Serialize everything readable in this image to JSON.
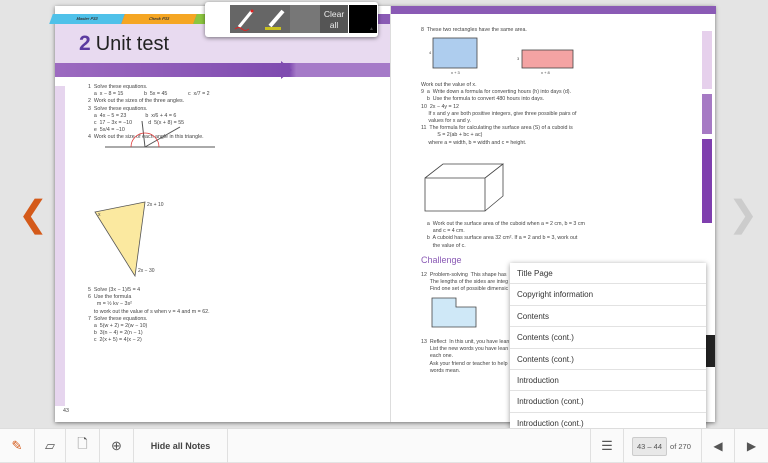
{
  "annotation_toolbar": {
    "pen_icon": "pen-icon",
    "highlighter_icon": "highlighter-icon",
    "clear_all": "Clear all",
    "color": "#000000"
  },
  "left_page": {
    "tabs": [
      {
        "label": "Master P33",
        "color": "#4fc1e9"
      },
      {
        "label": "Check P33",
        "color": "#f5a623"
      },
      {
        "label": "Stren",
        "color": "#8cc63f"
      }
    ],
    "chapter_number": "2",
    "title": "Unit test",
    "page_number": "43",
    "lines": [
      "1  Solve these equations.",
      "    a  x − 8 = 15              b  5x = 45              c  x/7 = 2",
      "2  Work out the sizes of the three angles.",
      "",
      "",
      "",
      "3  Solve these equations.",
      "    a  4x − 5 = 23             b  x/6 + 4 = 6",
      "    c  17 − 3x = −10           d  5(x + 8) = 55",
      "    e  5x/4 = −10",
      "4  Work out the size of each angle in this triangle."
    ],
    "triangle_labels": [
      "2x + 10",
      "2x − 30",
      "x"
    ],
    "lines2": [
      "5  Solve (3x − 1)/5 = 4",
      "6  Use the formula",
      "      m = ½ kv − 3s²",
      "    to work out the value of s when v = 4 and m = 62.",
      "7  Solve these equations.",
      "    a  5(w + 2) = 2(w − 10)",
      "    b  3(n − 4) = 2(n − 1)",
      "    c  2(x + 5) = 4(x − 2)"
    ]
  },
  "right_page": {
    "lines": [
      "8  These two rectangles have the same area."
    ],
    "rect_labels": [
      "4",
      "x + 3",
      "3",
      "x + 8"
    ],
    "lines2": [
      "Work out the value of x.",
      "9  a  Write down a formula for converting hours (h) into days (d).",
      "    b  Use the formula to convert 480 hours into days.",
      "10  2x − 4y = 12",
      "     If x and y are both positive integers, give three possible pairs of",
      "     values for x and y.",
      "11  The formula for calculating the surface area (S) of a cuboid is",
      "           S = 2(ab + bc + ac)",
      "     where a = width, b = width and c = height."
    ],
    "lines3": [
      "    a  Work out the surface area of the cuboid when a = 2 cm, b = 3 cm",
      "        and c = 4 cm.",
      "    b  A cuboid has surface area 32 cm². If a = 2 and b = 3, work out",
      "        the value of c."
    ],
    "challenge": "Challenge",
    "lines4": [
      "12  Problem-solving  This shape has",
      "      The lengths of the sides are integ",
      "      Find one set of possible dimensic"
    ],
    "lines5": [
      "13  Reflect  In this unit, you have lean",
      "      List the new words you have lean",
      "      each one.",
      "      Ask your friend or teacher to help",
      "      words mean."
    ]
  },
  "toc_menu": [
    "Title Page",
    "Copyright information",
    "Contents",
    "Contents (cont.)",
    "Contents (cont.)",
    "Introduction",
    "Introduction (cont.)",
    "Introduction (cont.)"
  ],
  "bottom_bar": {
    "hide_notes": "Hide all Notes",
    "page_range": "43 – 44",
    "total": "of 270"
  },
  "colors": {
    "accent": "#d45a1a",
    "purple": "#7f4bb0"
  }
}
